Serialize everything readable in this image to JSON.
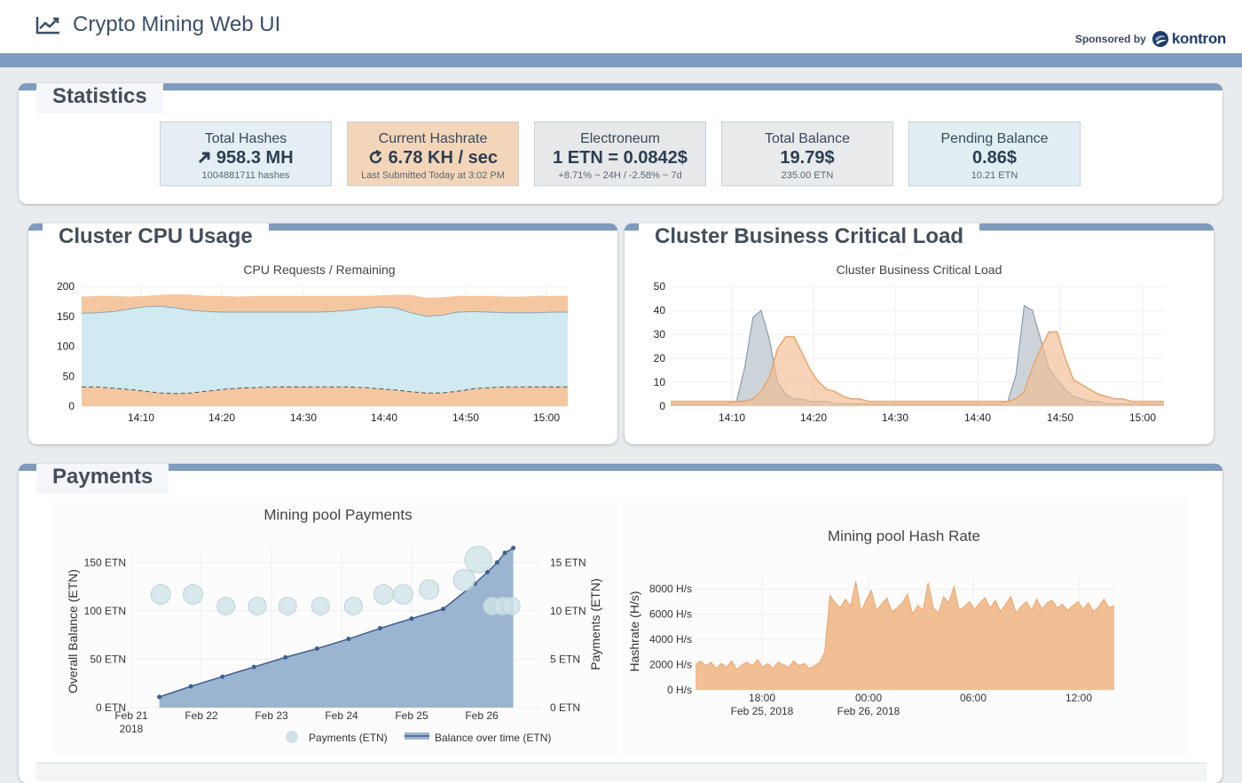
{
  "header": {
    "app_title": "Crypto Mining Web UI",
    "sponsor_label": "Sponsored by",
    "sponsor_name": "kontron"
  },
  "statistics": {
    "title": "Statistics",
    "cards": [
      {
        "title": "Total Hashes",
        "value": "958.3 MH",
        "sub": "1004881711 hashes",
        "icon": "trend-up-arrow-icon",
        "bg": "#e4eef3"
      },
      {
        "title": "Current Hashrate",
        "value": "6.78 KH / sec",
        "sub": "Last Submitted Today at 3:02 PM",
        "icon": "refresh-icon",
        "bg": "#f3d6b9"
      },
      {
        "title": "Electroneum",
        "value": "1 ETN = 0.0842$",
        "sub": "+8.71% ~ 24H / -2.58% ~ 7d",
        "bg": "#e6e8ea"
      },
      {
        "title": "Total Balance",
        "value": "19.79$",
        "sub": "235.00 ETN",
        "bg": "#e8eaec"
      },
      {
        "title": "Pending Balance",
        "value": "0.86$",
        "sub": "10.21 ETN",
        "bg": "#e1eef2"
      }
    ]
  },
  "cpu_panel": {
    "title": "Cluster CPU Usage"
  },
  "load_panel": {
    "title": "Cluster Business Critical Load"
  },
  "payments_panel": {
    "title": "Payments"
  },
  "colors": {
    "accent": "#7f9bbd",
    "orange": "#f2bd90",
    "cyan": "#cfeaf0",
    "balance_fill": "#9bb4d0",
    "balance_line": "#3d5f8f",
    "payments": "#cfe3e6",
    "hash_fill": "#f2bf94"
  },
  "chart_data": [
    {
      "type": "area",
      "title": "CPU Requests / Remaining",
      "x_ticks": [
        "14:10",
        "14:20",
        "14:30",
        "14:40",
        "14:50",
        "15:00"
      ],
      "y_ticks": [
        "0",
        "50",
        "100",
        "150",
        "200"
      ],
      "ylim": [
        0,
        200
      ],
      "series": [
        {
          "role": "bottom-band",
          "values": [
            32,
            32,
            30,
            28,
            25,
            22,
            21,
            22,
            25,
            28,
            30,
            31,
            32,
            32,
            32,
            32,
            32,
            32,
            31,
            29,
            27,
            24,
            22,
            22,
            25,
            29,
            31,
            32,
            32,
            32,
            32,
            32
          ]
        },
        {
          "role": "middle-band",
          "values": [
            155,
            156,
            158,
            162,
            166,
            167,
            164,
            160,
            158,
            157,
            157,
            157,
            157,
            157,
            157,
            157,
            158,
            160,
            163,
            166,
            164,
            156,
            150,
            152,
            157,
            158,
            157,
            156,
            156,
            156,
            157,
            157
          ]
        },
        {
          "role": "top-band",
          "values": [
            183,
            184,
            184,
            183,
            184,
            186,
            187,
            186,
            184,
            184,
            183,
            184,
            184,
            184,
            184,
            184,
            184,
            184,
            184,
            185,
            186,
            186,
            181,
            182,
            184,
            184,
            184,
            183,
            183,
            184,
            184,
            184
          ]
        }
      ]
    },
    {
      "type": "area",
      "title": "Cluster Business Critical Load",
      "x_ticks": [
        "14:10",
        "14:20",
        "14:30",
        "14:40",
        "14:50",
        "15:00"
      ],
      "y_ticks": [
        "0",
        "10",
        "20",
        "30",
        "40",
        "50"
      ],
      "ylim": [
        0,
        50
      ],
      "series": [
        {
          "role": "grey-peaks",
          "values": [
            1,
            1,
            1,
            1,
            1,
            1,
            1,
            1,
            2,
            16,
            37,
            40,
            28,
            10,
            5,
            3,
            3,
            2,
            2,
            2,
            1,
            1,
            1,
            1,
            1,
            1,
            1,
            1,
            1,
            1,
            1,
            1,
            1,
            1,
            1,
            1,
            1,
            1,
            1,
            1,
            1,
            2,
            13,
            42,
            40,
            28,
            16,
            11,
            7,
            4,
            3,
            2,
            2,
            1,
            1,
            1,
            1,
            1,
            1,
            1,
            1
          ]
        },
        {
          "role": "orange-band",
          "values": [
            2,
            2,
            2,
            2,
            2,
            2,
            2,
            2,
            2,
            2,
            3,
            6,
            12,
            24,
            29,
            29,
            22,
            15,
            10,
            7,
            6,
            4,
            3,
            3,
            2,
            2,
            2,
            2,
            2,
            2,
            2,
            2,
            2,
            2,
            2,
            2,
            2,
            2,
            2,
            2,
            2,
            2,
            3,
            6,
            16,
            24,
            31,
            31,
            20,
            11,
            9,
            7,
            5,
            4,
            3,
            3,
            2,
            2,
            2,
            2,
            2
          ]
        }
      ]
    },
    {
      "type": "line",
      "title": "Mining pool Payments",
      "x_ticks": [
        "Feb 21",
        "Feb 22",
        "Feb 23",
        "Feb 24",
        "Feb 25",
        "Feb 26"
      ],
      "x_tick_sub": "2018",
      "ylabel": "Overall Balance (ETN)",
      "y_ticks": [
        "0 ETN",
        "50 ETN",
        "100 ETN",
        "150 ETN"
      ],
      "ylim": [
        0,
        165
      ],
      "y2label": "Payments (ETN)",
      "y2_ticks": [
        "0 ETN",
        "5 ETN",
        "10 ETN",
        "15 ETN"
      ],
      "y2lim": [
        0,
        16.5
      ],
      "legend": [
        "Payments (ETN)",
        "Balance over time (ETN)"
      ],
      "series": [
        {
          "name": "Balance over time (ETN)",
          "x": [
            21.4,
            21.85,
            22.3,
            22.75,
            23.2,
            23.65,
            24.1,
            24.55,
            25.0,
            25.45,
            25.9,
            26.08,
            26.22,
            26.33,
            26.45
          ],
          "values": [
            11,
            22,
            32,
            42,
            52,
            61,
            71,
            82,
            92,
            102,
            128,
            140,
            150,
            160,
            165
          ]
        },
        {
          "name": "Payments (ETN)",
          "x": [
            21.42,
            21.88,
            22.35,
            22.8,
            23.23,
            23.7,
            24.17,
            24.6,
            24.88,
            25.25,
            25.75,
            25.95,
            26.15,
            26.3,
            26.42
          ],
          "values": [
            11.7,
            11.7,
            10.5,
            10.5,
            10.5,
            10.5,
            10.5,
            11.7,
            11.7,
            12.2,
            13.2,
            15.3,
            10.5,
            10.5,
            10.5
          ]
        }
      ]
    },
    {
      "type": "area",
      "title": "Mining pool Hash Rate",
      "ylabel": "Hashrate (H/s)",
      "x_ticks": [
        "18:00",
        "00:00",
        "06:00",
        "12:00"
      ],
      "x_tick_sub": [
        "Feb 25, 2018",
        "Feb 26, 2018"
      ],
      "y_ticks": [
        "0 H/s",
        "2000 H/s",
        "4000 H/s",
        "6000 H/s",
        "8000 H/s"
      ],
      "ylim": [
        0,
        9000
      ],
      "series": [
        {
          "name": "Hashrate",
          "values": [
            2000,
            2300,
            1900,
            2200,
            1700,
            2100,
            1800,
            2300,
            1600,
            2000,
            2200,
            1900,
            2400,
            1800,
            2100,
            1700,
            2200,
            2000,
            1800,
            2300,
            1900,
            2100,
            1700,
            1900,
            2200,
            3000,
            7500,
            6900,
            6500,
            7200,
            6600,
            8600,
            6200,
            7100,
            7900,
            6300,
            6800,
            7300,
            6200,
            6500,
            6900,
            7600,
            6000,
            6700,
            6300,
            8500,
            6500,
            6100,
            7400,
            6900,
            8200,
            6300,
            6600,
            7000,
            6400,
            6900,
            7300,
            6500,
            7100,
            6200,
            6800,
            7400,
            6100,
            6600,
            7000,
            6300,
            7200,
            6400,
            6900,
            7100,
            6500,
            6800,
            6300,
            6700,
            7000,
            6400,
            6900,
            6200,
            6600,
            7200,
            6500,
            6700
          ]
        }
      ]
    }
  ]
}
